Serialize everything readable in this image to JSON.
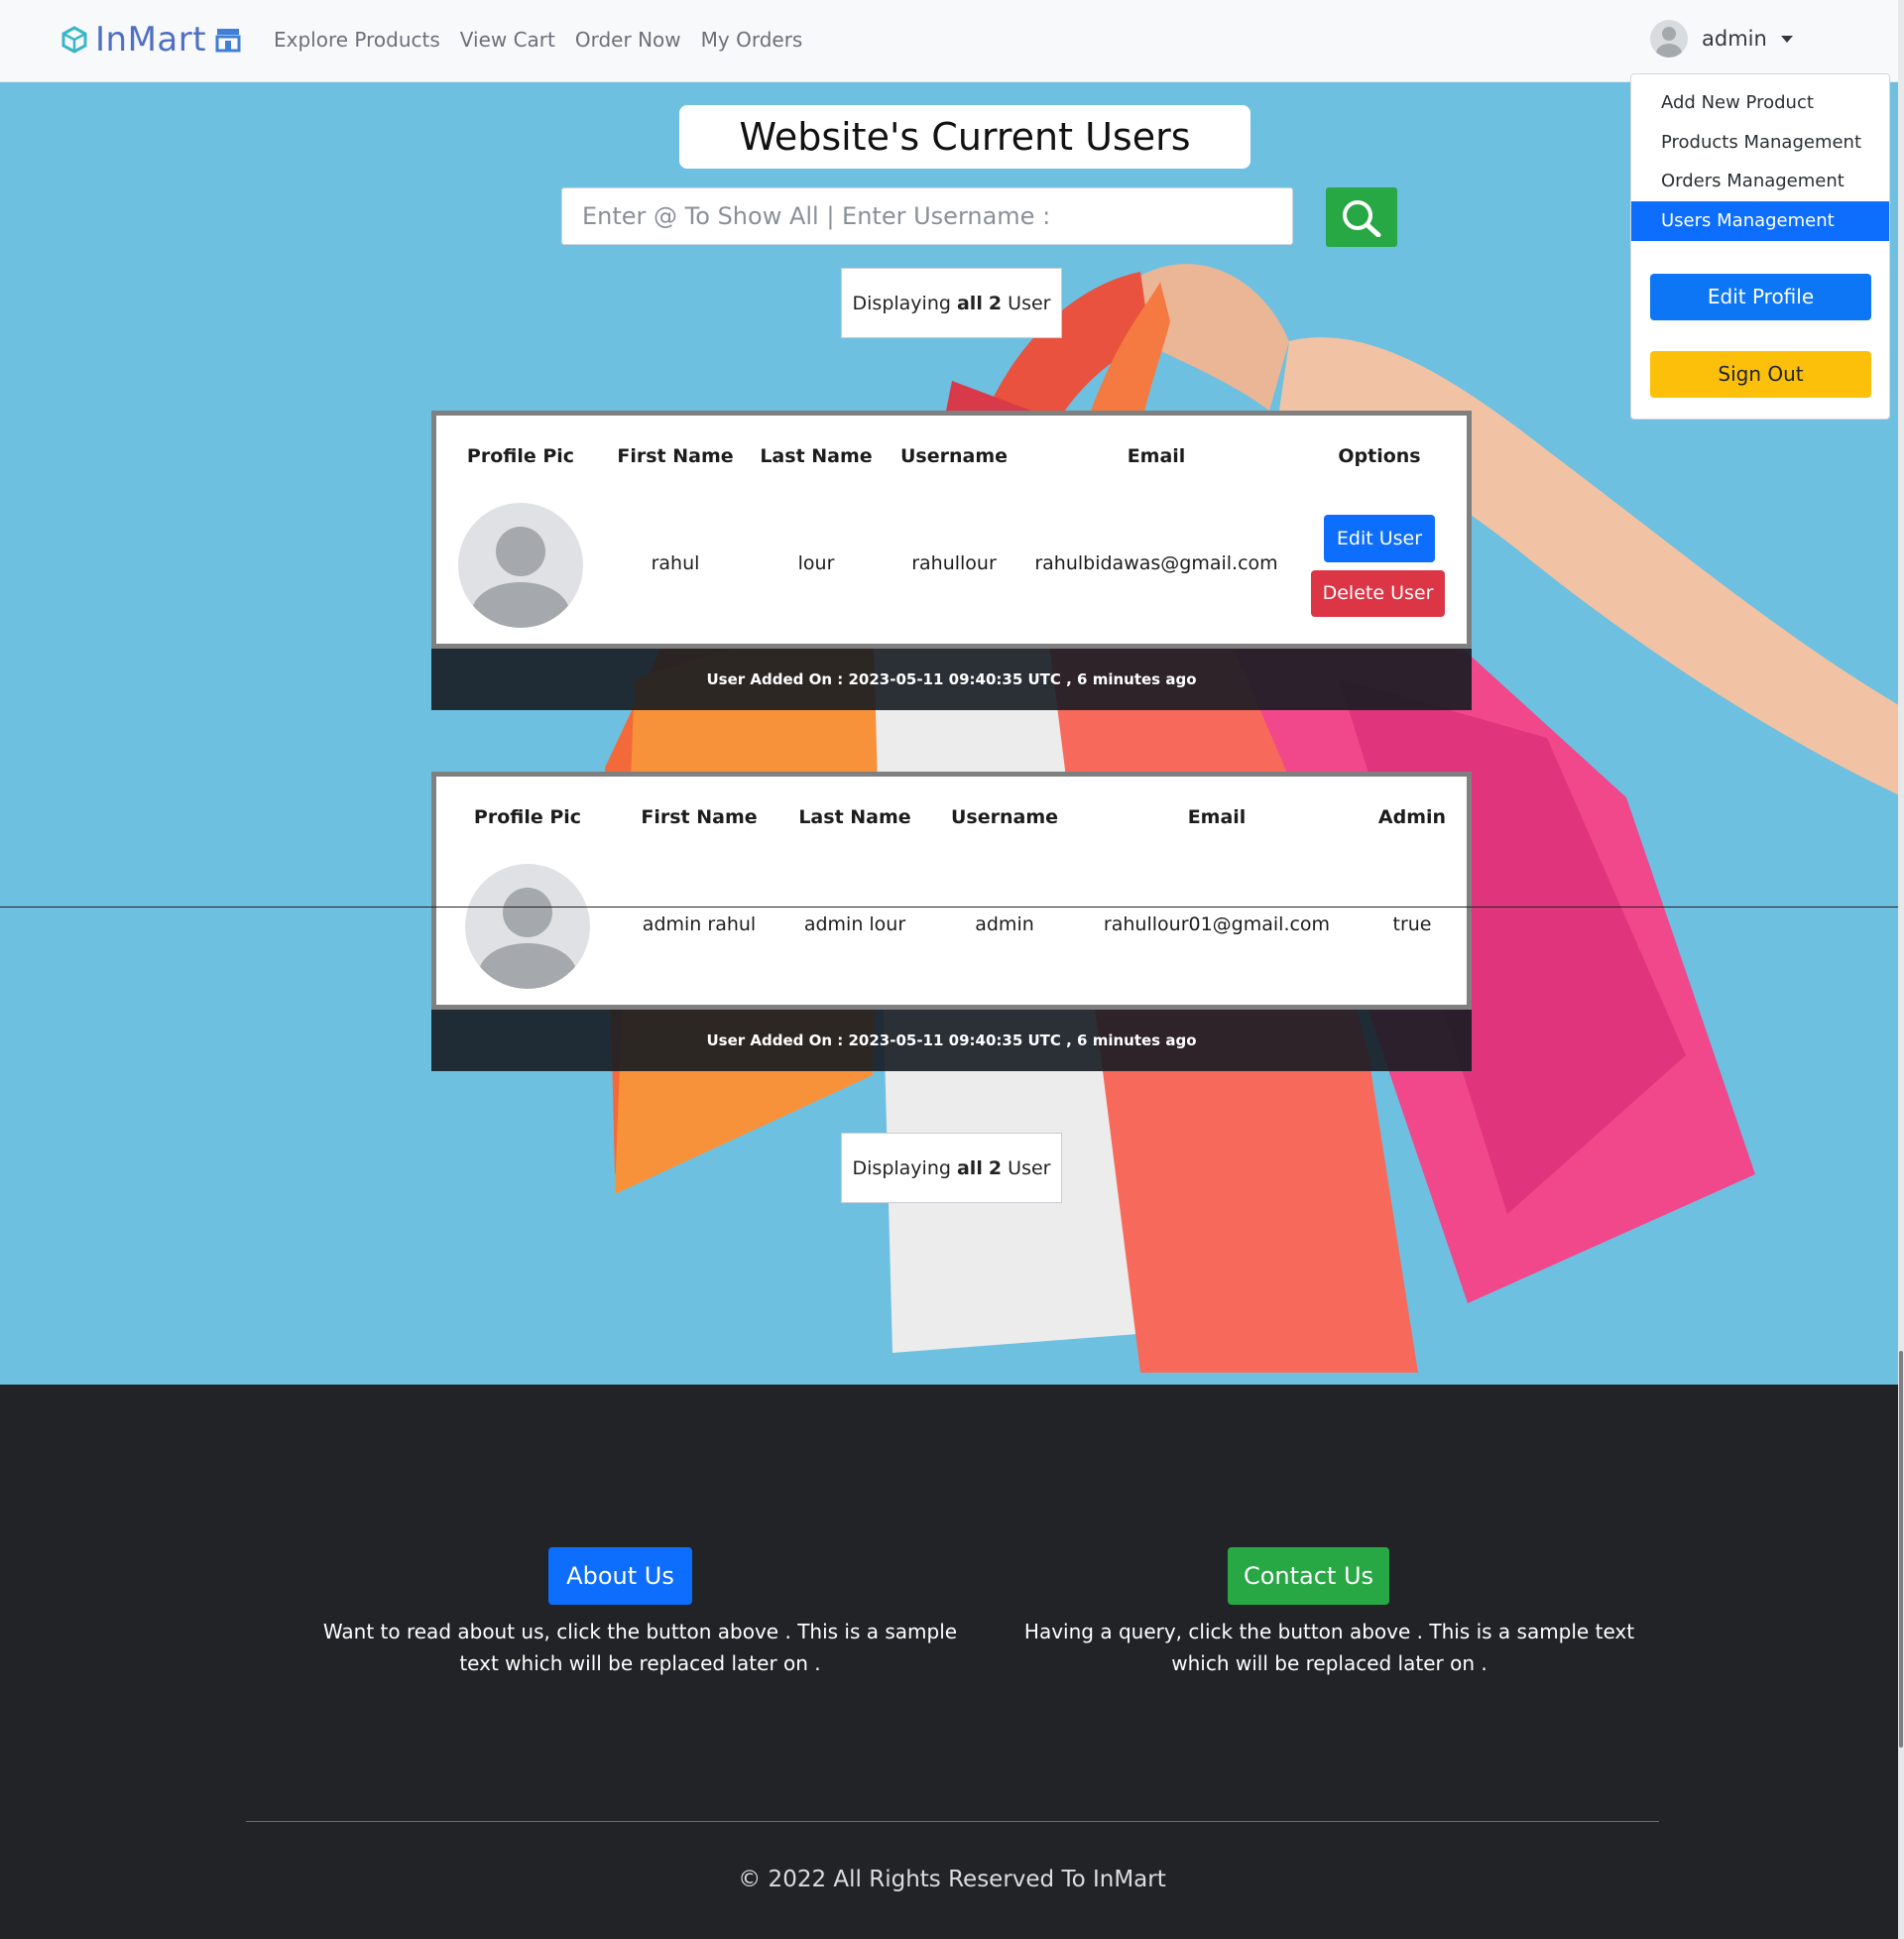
{
  "navbar": {
    "brand": "InMart",
    "links": [
      "Explore Products",
      "View Cart",
      "Order Now",
      "My Orders"
    ],
    "user": "admin"
  },
  "dropdown": {
    "items": [
      "Add New Product",
      "Products Management",
      "Orders Management",
      "Users Management"
    ],
    "active_item": "Users Management",
    "edit_profile": "Edit Profile",
    "sign_out": "Sign Out"
  },
  "main": {
    "title": "Website's Current Users",
    "search_placeholder": "Enter @ To Show All | Enter Username :",
    "count_prefix": "Displaying",
    "count_all": "all",
    "count_num": "2",
    "count_suffix": "User"
  },
  "users": [
    {
      "headers": [
        "Profile Pic",
        "First Name",
        "Last Name",
        "Username",
        "Email",
        "Options"
      ],
      "first_name": "rahul",
      "last_name": "lour",
      "username": "rahullour",
      "email": "rahulbidawas@gmail.com",
      "edit_label": "Edit User",
      "delete_label": "Delete User",
      "added_on": "User Added On : 2023-05-11 09:40:35 UTC , 6 minutes ago"
    },
    {
      "headers": [
        "Profile Pic",
        "First Name",
        "Last Name",
        "Username",
        "Email",
        "Admin"
      ],
      "first_name": "admin rahul",
      "last_name": "admin lour",
      "username": "admin",
      "email": "rahullour01@gmail.com",
      "admin": "true",
      "added_on": "User Added On : 2023-05-11 09:40:35 UTC , 6 minutes ago"
    }
  ],
  "footer": {
    "about_btn": "About Us",
    "about_text": "Want to read about us, click the button above . This is a sample text which will be replaced later on .",
    "contact_btn": "Contact Us",
    "contact_text": "Having a query, click the button above . This is a sample text which will be replaced later on .",
    "copyright": "© 2022 All Rights Reserved To InMart"
  },
  "colors": {
    "background": "#6ec0e1",
    "primary": "#0d6efd",
    "success": "#28a745",
    "danger": "#dc3545",
    "warning": "#fcc00b",
    "footer": "#212327"
  }
}
